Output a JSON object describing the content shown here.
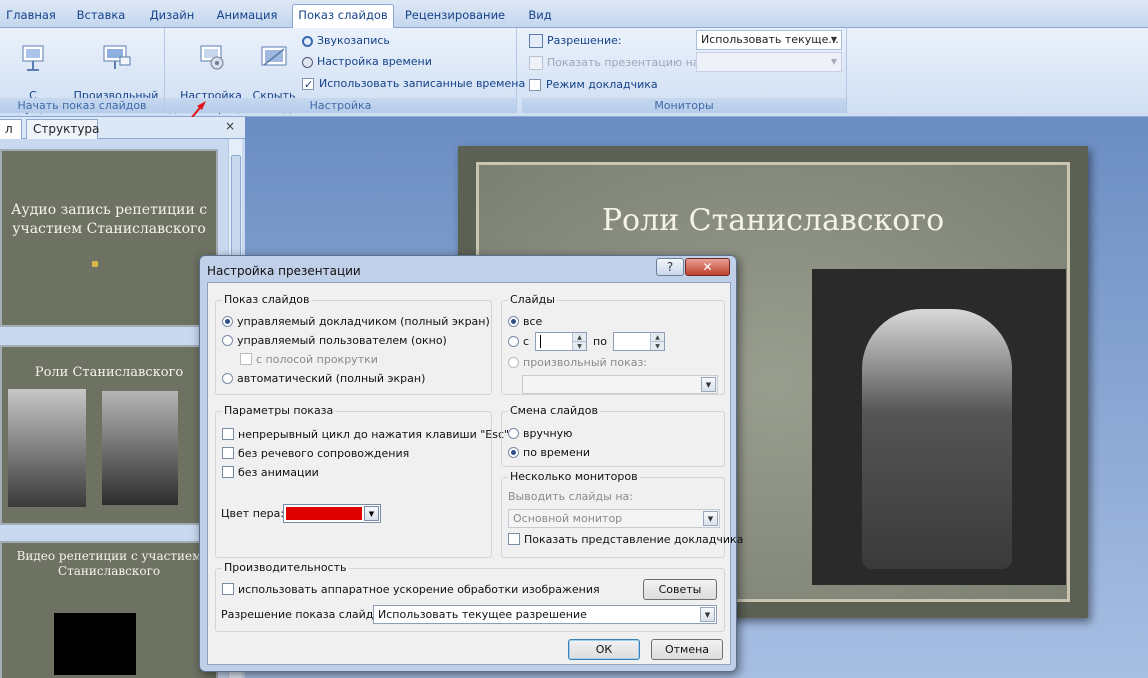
{
  "tabs": [
    "Главная",
    "Вставка",
    "Дизайн",
    "Анимация",
    "Показ слайдов",
    "Рецензирование",
    "Вид"
  ],
  "ribbon": {
    "start": {
      "from_current": "С текущего\nслайда",
      "custom": "Произвольный\nпоказ",
      "label": "Начать показ слайдов"
    },
    "setup": {
      "setup_show": "Настройка\nдемонстрации",
      "hide_slide": "Скрыть\nслайд",
      "record": "Звукозапись",
      "rehearse": "Настройка времени",
      "use_timings": "Использовать записанные времена",
      "label": "Настройка"
    },
    "monitors": {
      "resolution_label": "Разрешение:",
      "resolution_value": "Использовать текуще...",
      "show_on_label": "Показать презентацию на:",
      "presenter_view": "Режим докладчика",
      "label": "Мониторы"
    }
  },
  "side_panel": {
    "tab_slides": "л",
    "tab_outline": "Структура",
    "close": "×",
    "thumb1_title": "Аудио запись репетиции с участием Станиславского",
    "thumb2_title": "Роли Станиславского",
    "thumb3_title": "Видео репетиции с участием Станиславского"
  },
  "slide": {
    "title": "Роли Станиславского"
  },
  "dialog": {
    "title": "Настройка презентации",
    "help": "?",
    "close": "✕",
    "show_type": {
      "legend": "Показ слайдов",
      "presenter": "управляемый докладчиком (полный экран)",
      "browsed": "управляемый пользователем (окно)",
      "scrollbar": "с полосой прокрутки",
      "kiosk": "автоматический (полный экран)"
    },
    "slides": {
      "legend": "Слайды",
      "all": "все",
      "from": "с",
      "to": "по",
      "custom": "произвольный показ:"
    },
    "options": {
      "legend": "Параметры показа",
      "loop": "непрерывный цикл до нажатия клавиши \"Esc\"",
      "no_narration": "без речевого сопровождения",
      "no_animation": "без анимации",
      "pen_color": "Цвет пера:",
      "pen_color_value": "#e00000"
    },
    "advance": {
      "legend": "Смена слайдов",
      "manual": "вручную",
      "timings": "по времени"
    },
    "monitors": {
      "legend": "Несколько мониторов",
      "display_on": "Выводить слайды на:",
      "display_value": "Основной монитор",
      "presenter_view": "Показать представление докладчика"
    },
    "performance": {
      "legend": "Производительность",
      "hw_accel": "использовать аппаратное ускорение обработки изображения",
      "tips": "Советы",
      "resolution_label": "Разрешение показа слайдов:",
      "resolution_value": "Использовать текущее разрешение"
    },
    "ok": "ОК",
    "cancel": "Отмена"
  }
}
